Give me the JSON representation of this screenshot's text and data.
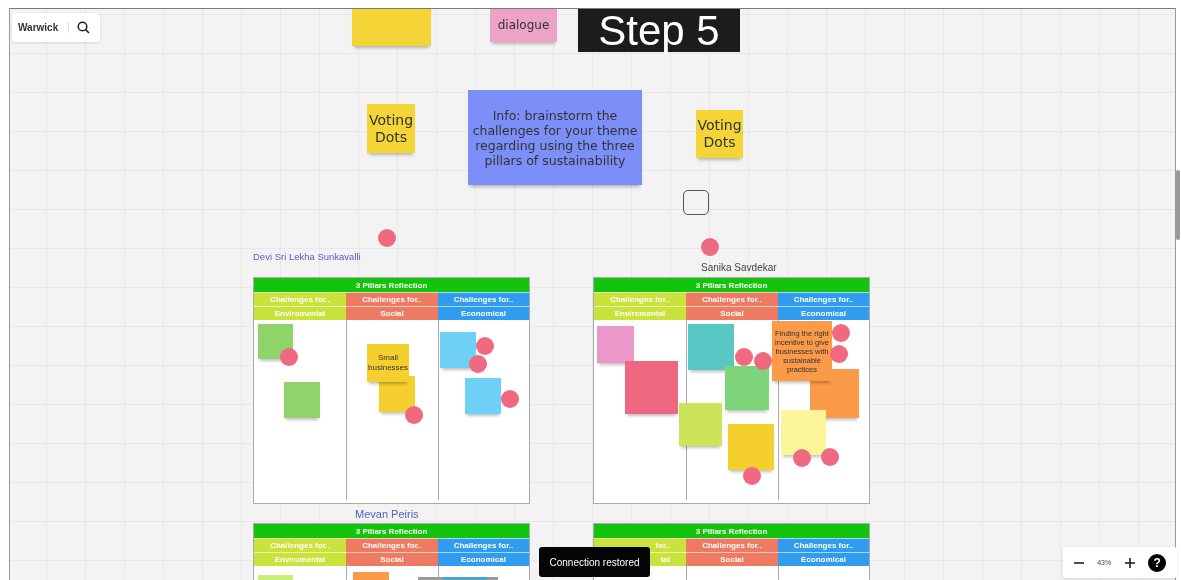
{
  "toolbar": {
    "board_name": "Warwick"
  },
  "canvas_items": [
    {
      "kind": "sticky",
      "color": "#f5d438"
    },
    {
      "kind": "sticky",
      "text": "dialogue",
      "color": "#eca3c6"
    },
    {
      "kind": "title_block",
      "text": "Step 5"
    },
    {
      "kind": "sticky",
      "text": "Voting Dots",
      "color": "#f5d438"
    },
    {
      "kind": "sticky",
      "text": "Info: brainstorm  the challenges for your theme regarding using the three pillars of sustainability",
      "color": "#7c8ef7"
    },
    {
      "kind": "sticky",
      "text": "Voting Dots",
      "color": "#f5d438"
    },
    {
      "kind": "shape"
    },
    {
      "kind": "dot"
    },
    {
      "kind": "dot"
    },
    {
      "kind": "label",
      "text": "Devi Sri Lekha Sunkavalli",
      "color": "#5b5bc0"
    },
    {
      "kind": "label",
      "text": "Sanika Savdekar",
      "color": "#444444"
    },
    {
      "kind": "label",
      "text": "Mevan Peiris",
      "color": "#5b5bc0"
    }
  ],
  "boards": [
    {
      "title": "3 Pillars Reflection",
      "columns": [
        {
          "header": "Challenges for..",
          "name": "Enviromental",
          "color": "#c9e33b"
        },
        {
          "header": "Challenges for..",
          "name": "Social",
          "color": "#ef7a62"
        },
        {
          "header": "Challenges for..",
          "name": "Economical",
          "color": "#2f9cf0"
        }
      ],
      "notes": [
        {
          "color": "#8fd36b"
        },
        {
          "color": "#8fd36b"
        },
        {
          "text": "Small businesses",
          "color": "#f5cf2e"
        },
        {
          "color": "#f5cf2e"
        },
        {
          "color": "#6fd0f5"
        },
        {
          "color": "#6fd0f5"
        }
      ]
    },
    {
      "title": "3 Pillars Reflection",
      "columns": [
        {
          "header": "Challenges for..",
          "name": "Enviromental",
          "color": "#c9e33b"
        },
        {
          "header": "Challenges for..",
          "name": "Social",
          "color": "#ef7a62"
        },
        {
          "header": "Challenges for..",
          "name": "Economical",
          "color": "#2f9cf0"
        }
      ],
      "notes": [
        {
          "color": "#ec97c9"
        },
        {
          "color": "#ee6781"
        },
        {
          "color": "#56c7c2"
        },
        {
          "color": "#7fd37a"
        },
        {
          "color": "#cde35a"
        },
        {
          "color": "#f5cf2e"
        },
        {
          "text": "Finding the right incentive to give businesses with sustainable practices",
          "color": "#fb9a48"
        },
        {
          "color": "#fb9a48"
        },
        {
          "color": "#fdf59a"
        }
      ]
    },
    {
      "title": "3 Pillars Reflection",
      "columns": [
        {
          "header": "Challenges for..",
          "name": "Enviromental",
          "color": "#c9e33b"
        },
        {
          "header": "Challenges for..",
          "name": "Social",
          "color": "#ef7a62"
        },
        {
          "header": "Challenges for..",
          "name": "Economical",
          "color": "#2f9cf0"
        }
      ],
      "notes": [
        {
          "color": "#c9ef7a"
        },
        {
          "color": "#fb9a48"
        },
        {
          "color": "#9a9a9a"
        },
        {
          "color": "#4aa6c9"
        }
      ]
    },
    {
      "title": "3 Pillars Reflection",
      "columns": [
        {
          "header": "for..",
          "name": "tal",
          "color": "#c9e33b"
        },
        {
          "header": "Challenges for..",
          "name": "Social",
          "color": "#ef7a62"
        },
        {
          "header": "Challenges for..",
          "name": "Economical",
          "color": "#2f9cf0"
        }
      ]
    }
  ],
  "toast": {
    "text": "Connection restored"
  },
  "zoom": {
    "value": "43%",
    "help": "?"
  }
}
